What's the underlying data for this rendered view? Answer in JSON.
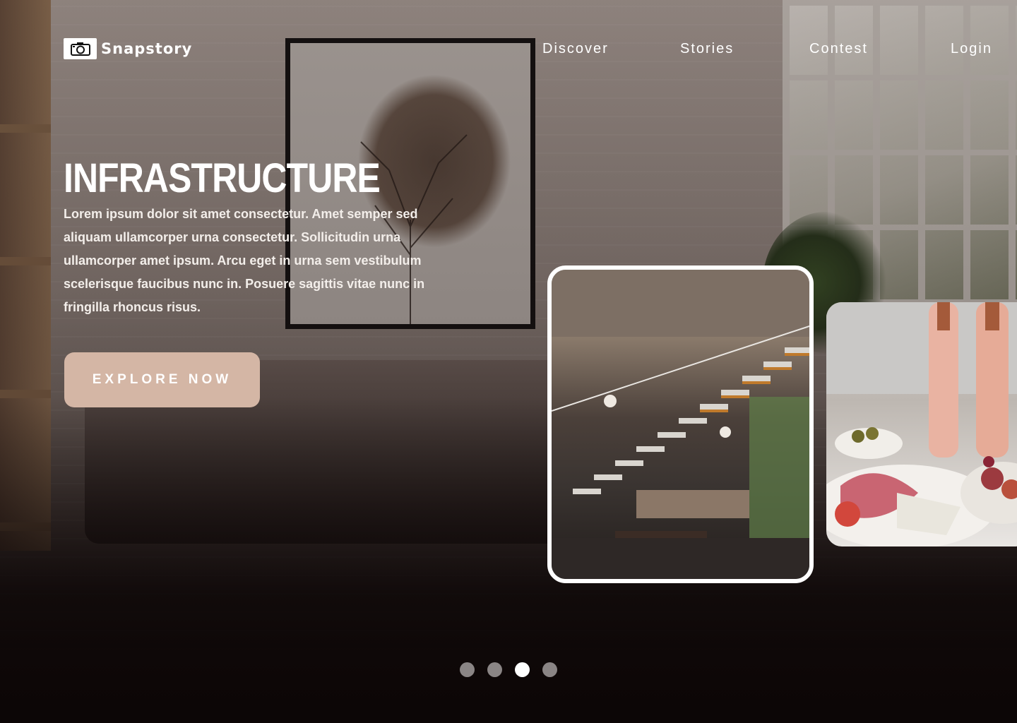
{
  "brand": {
    "name": "Snapstory",
    "icon": "camera-icon"
  },
  "nav": {
    "items": [
      {
        "label": "Discover"
      },
      {
        "label": "Stories"
      },
      {
        "label": "Contest"
      },
      {
        "label": "Login"
      }
    ]
  },
  "hero": {
    "title": "INFRASTRUCTURE",
    "description": "Lorem ipsum dolor sit amet consectetur. Amet semper sed aliquam ullamcorper urna consectetur. Sollicitudin urna ullamcorper amet ipsum. Arcu eget in urna sem vestibulum scelerisque faucibus nunc in. Posuere sagittis vitae nunc in fringilla rhoncus risus.",
    "cta_label": "EXPLORE NOW"
  },
  "slider": {
    "cards": [
      {
        "subject": "staircase-interior"
      },
      {
        "subject": "rose-wine-charcuterie"
      }
    ],
    "pagination": {
      "total": 4,
      "active": 3
    }
  },
  "colors": {
    "accent": "#d4b6a5",
    "dot_inactive": "#8a8585",
    "dot_active": "#ffffff"
  }
}
